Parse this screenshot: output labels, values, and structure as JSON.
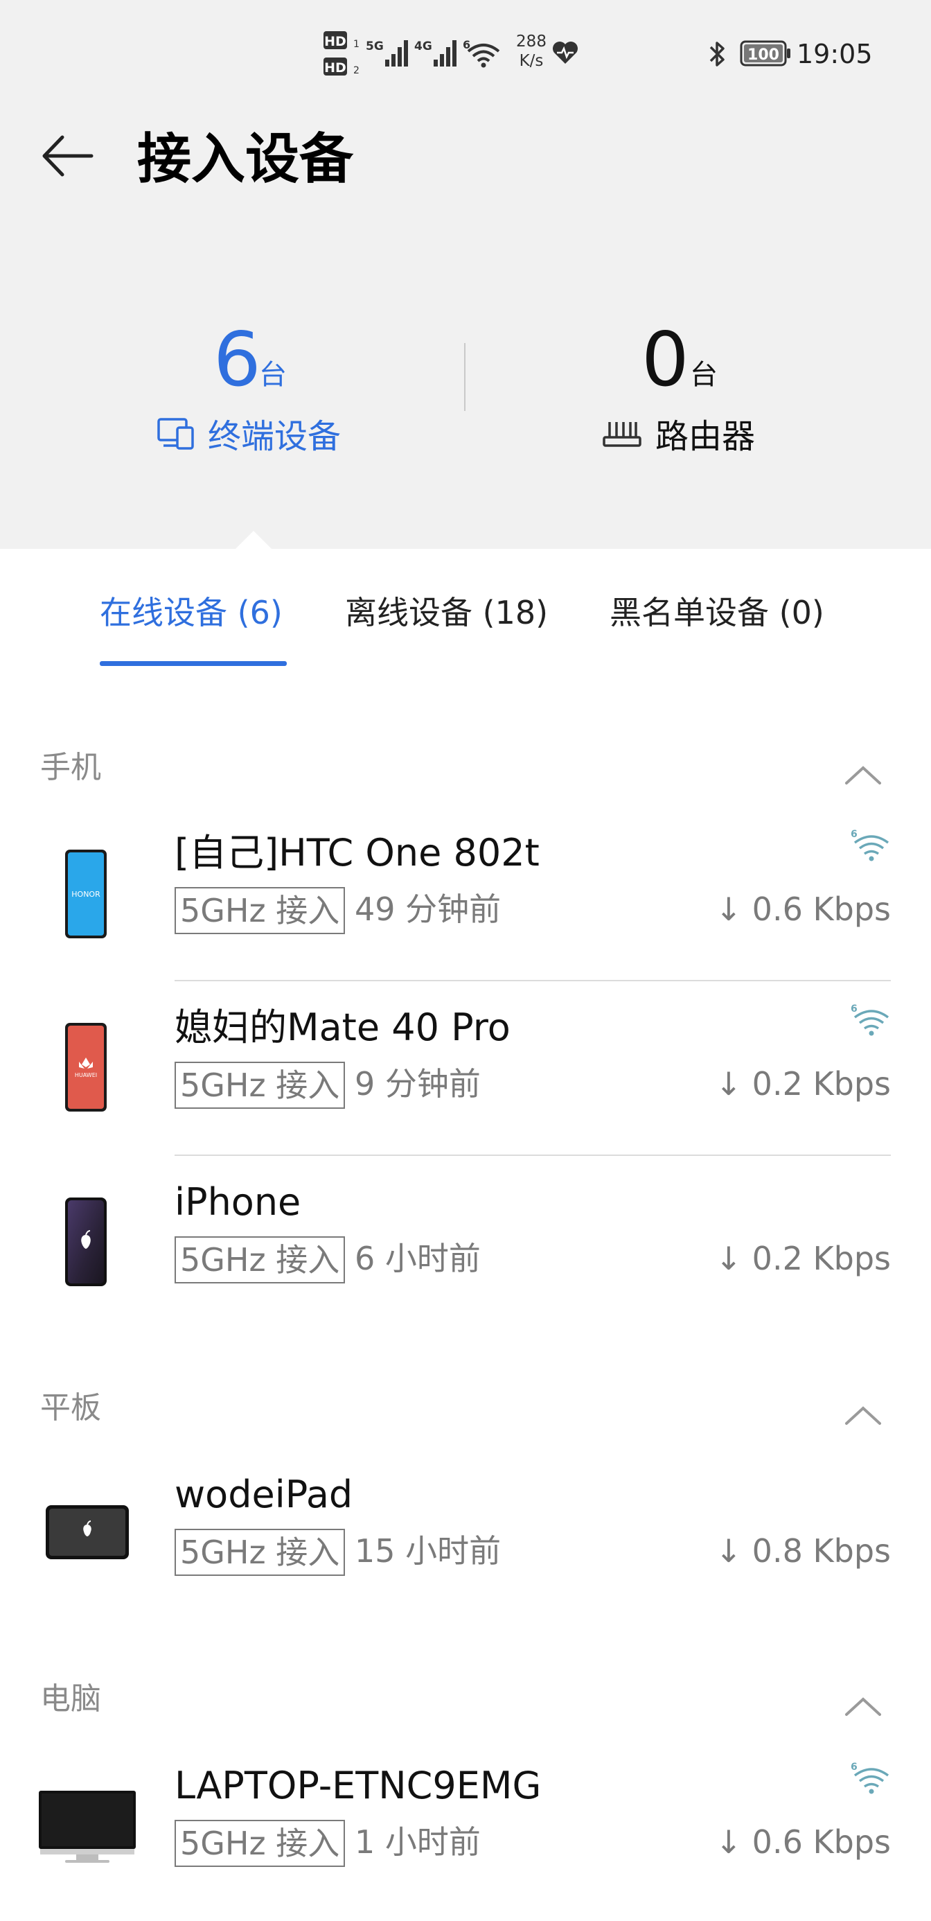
{
  "status_bar": {
    "hd1": "HD",
    "hd2": "HD",
    "sig1": "5G",
    "sig2": "4G",
    "wifi_sup": "6",
    "net_speed_value": "288",
    "net_speed_unit": "K/s",
    "battery": "100",
    "time": "19:05"
  },
  "header": {
    "title": "接入设备"
  },
  "stats": {
    "terminal": {
      "count": "6",
      "unit": "台",
      "label": "终端设备"
    },
    "router": {
      "count": "0",
      "unit": "台",
      "label": "路由器"
    }
  },
  "tabs": [
    {
      "label": "在线设备 (6)"
    },
    {
      "label": "离线设备 (18)"
    },
    {
      "label": "黑名单设备 (0)"
    }
  ],
  "sections": [
    {
      "title": "手机",
      "devices": [
        {
          "name": "[自己]HTC One 802t",
          "band": "5GHz 接入",
          "ago": "49 分钟前",
          "speed": "↓ 0.6 Kbps",
          "wifi6": true,
          "image": "honor-phone"
        },
        {
          "name": "媳妇的Mate 40 Pro",
          "band": "5GHz 接入",
          "ago": "9 分钟前",
          "speed": "↓ 0.2 Kbps",
          "wifi6": true,
          "image": "huawei-phone"
        },
        {
          "name": "iPhone",
          "band": "5GHz 接入",
          "ago": "6 小时前",
          "speed": "↓ 0.2 Kbps",
          "wifi6": false,
          "image": "iphone"
        }
      ]
    },
    {
      "title": "平板",
      "devices": [
        {
          "name": "wodeiPad",
          "band": "5GHz 接入",
          "ago": "15 小时前",
          "speed": "↓ 0.8 Kbps",
          "wifi6": false,
          "image": "ipad"
        }
      ]
    },
    {
      "title": "电脑",
      "devices": [
        {
          "name": "LAPTOP-ETNC9EMG",
          "band": "5GHz 接入",
          "ago": "1 小时前",
          "speed": "↓ 0.6 Kbps",
          "wifi6": true,
          "image": "monitor"
        }
      ]
    }
  ],
  "logos": {
    "honor": "HONOR",
    "huawei": "HUAWEI"
  },
  "colors": {
    "accent": "#2f6fde",
    "muted": "#7a7a7a",
    "wifi6": "#6aa8b8",
    "top_bg": "#f1f1f1"
  }
}
